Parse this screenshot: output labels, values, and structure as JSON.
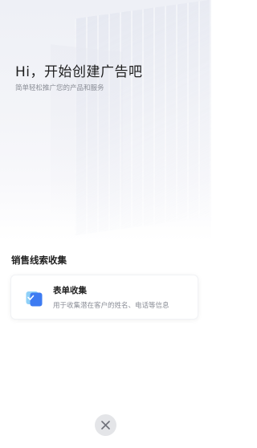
{
  "hero": {
    "title": "Hi，开始创建广告吧",
    "subtitle": "简单轻松推广您的产品和服务"
  },
  "section": {
    "title": "销售线索收集"
  },
  "card": {
    "title": "表单收集",
    "description": "用于收集潜在客户的姓名、电话等信息",
    "icon": "form-icon"
  },
  "close": {
    "icon": "close-icon"
  },
  "colors": {
    "accent": "#3d7bf2",
    "accent_light": "#8fd0f8",
    "close_bg": "#e4e5e8"
  }
}
